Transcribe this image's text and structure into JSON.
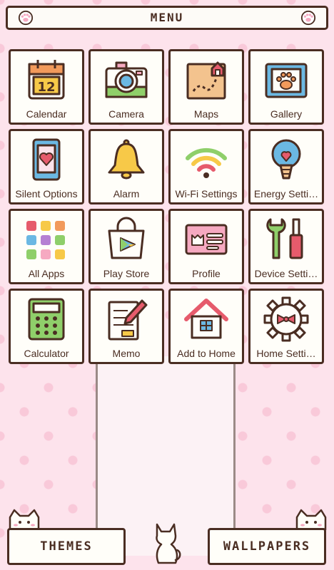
{
  "header": {
    "title": "MENU"
  },
  "tiles": [
    {
      "label": "Calendar",
      "icon": "calendar-icon",
      "day": "12"
    },
    {
      "label": "Camera",
      "icon": "camera-icon"
    },
    {
      "label": "Maps",
      "icon": "map-icon"
    },
    {
      "label": "Gallery",
      "icon": "gallery-icon"
    },
    {
      "label": "Silent Options",
      "icon": "silent-phone-icon"
    },
    {
      "label": "Alarm",
      "icon": "bell-icon"
    },
    {
      "label": "Wi-Fi Settings",
      "icon": "wifi-icon"
    },
    {
      "label": "Energy Setti…",
      "icon": "lightbulb-icon"
    },
    {
      "label": "All Apps",
      "icon": "apps-grid-icon"
    },
    {
      "label": "Play Store",
      "icon": "shopping-bag-icon"
    },
    {
      "label": "Profile",
      "icon": "profile-card-icon"
    },
    {
      "label": "Device Setti…",
      "icon": "tools-icon"
    },
    {
      "label": "Calculator",
      "icon": "calculator-icon"
    },
    {
      "label": "Memo",
      "icon": "memo-icon"
    },
    {
      "label": "Add to Home",
      "icon": "house-icon"
    },
    {
      "label": "Home Setti…",
      "icon": "gear-icon"
    }
  ],
  "bottom": {
    "themes_label": "THEMES",
    "wallpapers_label": "WALLPAPERS"
  },
  "colors": {
    "outline": "#4a2d22",
    "background": "#fde3ec",
    "dots": "#f9c9d9",
    "tile": "#fffef9"
  }
}
